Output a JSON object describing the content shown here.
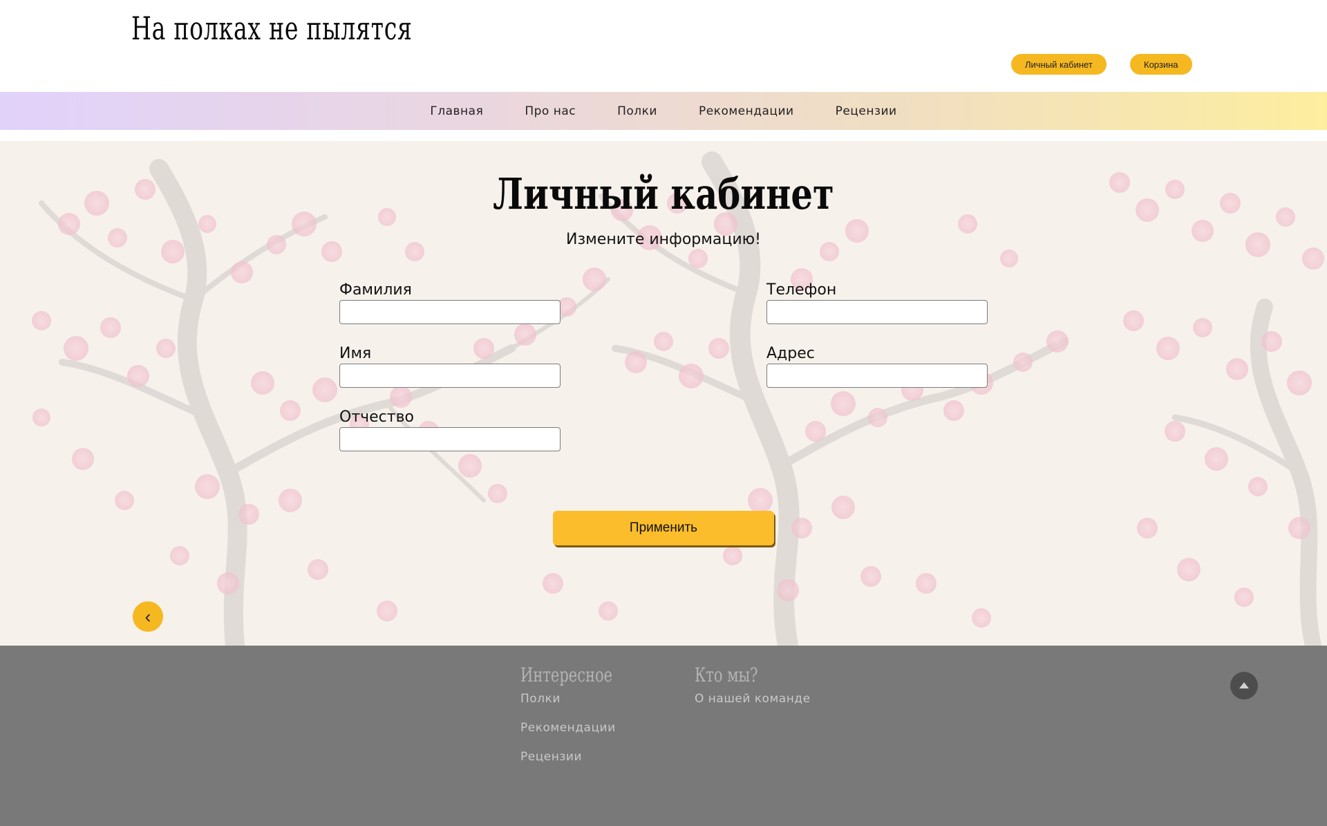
{
  "header": {
    "logo": "На полках не пылятся",
    "account_button": "Личный кабинет",
    "cart_button": "Корзина"
  },
  "nav": {
    "items": [
      "Главная",
      "Про нас",
      "Полки",
      "Рекомендации",
      "Рецензии"
    ]
  },
  "main": {
    "title": "Личный кабинет",
    "subtitle": "Измените информацию!",
    "fields": {
      "surname": "Фамилия",
      "name": "Имя",
      "patronymic": "Отчество",
      "phone": "Телефон",
      "address": "Адрес"
    },
    "apply_button": "Применить",
    "back_icon": "chevron-left-icon"
  },
  "footer": {
    "col1": {
      "title": "Интересное",
      "links": [
        "Полки",
        "Рекомендации",
        "Рецензии"
      ]
    },
    "col2": {
      "title": "Кто мы?",
      "links": [
        "О нашей команде"
      ]
    },
    "to_top_icon": "caret-up-icon"
  },
  "colors": {
    "accent": "#f5b820",
    "footer_bg": "#797979",
    "nav_gradient_start": "#e1d2fb",
    "nav_gradient_end": "#fdee9f"
  }
}
